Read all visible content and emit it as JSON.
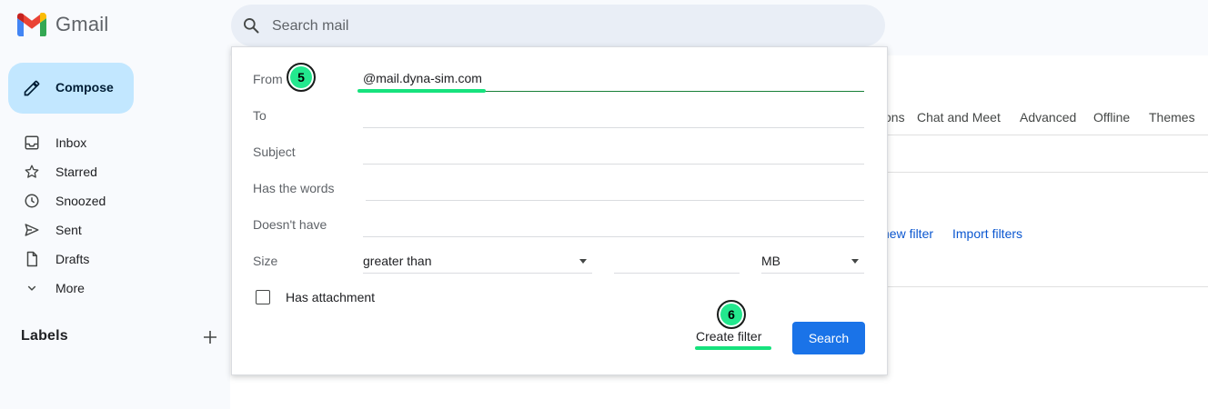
{
  "app": {
    "name": "Gmail"
  },
  "search": {
    "placeholder": "Search mail"
  },
  "sidebar": {
    "compose_label": "Compose",
    "items": [
      {
        "label": "Inbox",
        "icon": "inbox-icon"
      },
      {
        "label": "Starred",
        "icon": "star-icon"
      },
      {
        "label": "Snoozed",
        "icon": "clock-icon"
      },
      {
        "label": "Sent",
        "icon": "send-icon"
      },
      {
        "label": "Drafts",
        "icon": "draft-icon"
      },
      {
        "label": "More",
        "icon": "chevron-down-icon"
      }
    ],
    "labels_title": "Labels"
  },
  "settings": {
    "tabs": [
      "ons",
      "Chat and Meet",
      "Advanced",
      "Offline",
      "Themes"
    ],
    "new_filter_link": "new filter",
    "import_filters_link": "Import filters"
  },
  "filter_form": {
    "from_label": "From",
    "from_value": "@mail.dyna-sim.com",
    "to_label": "To",
    "subject_label": "Subject",
    "has_words_label": "Has the words",
    "doesnt_have_label": "Doesn't have",
    "size_label": "Size",
    "size_operator": "greater than",
    "size_unit": "MB",
    "has_attachment_label": "Has attachment",
    "create_filter_label": "Create filter",
    "search_button_label": "Search"
  },
  "annotations": {
    "step_from": "5",
    "step_create": "6"
  },
  "colors": {
    "accent": "#1a73e8",
    "compose_bg": "#c2e7ff",
    "highlight": "#16e27d",
    "step_badge": "#23e88e"
  }
}
